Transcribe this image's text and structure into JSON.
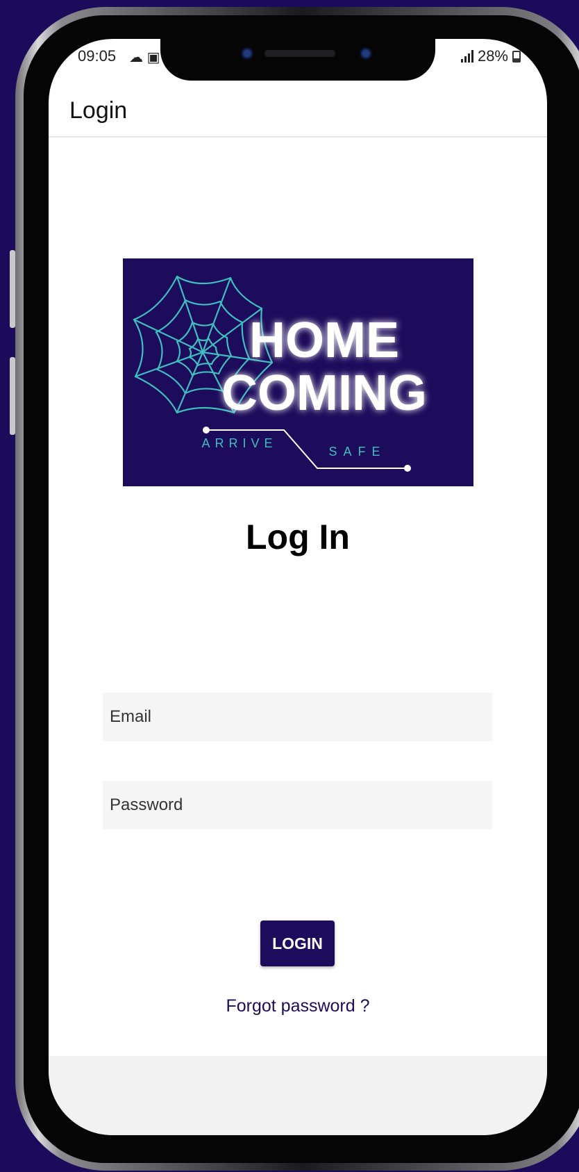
{
  "status_bar": {
    "time": "09:05",
    "left_icons": [
      "cloud-icon",
      "youtube-icon"
    ],
    "battery": "28%"
  },
  "app_bar": {
    "title": "Login"
  },
  "logo": {
    "line1": "HOME",
    "line2": "COMING",
    "tag_left": "ARRIVE",
    "tag_right": "SAFE",
    "colors": {
      "background": "#1d0b5b",
      "web": "#3fbfc0",
      "text": "#ffffff"
    }
  },
  "heading": "Log In",
  "form": {
    "email_placeholder": "Email",
    "password_placeholder": "Password",
    "login_label": "LOGIN",
    "forgot_label": "Forgot password ?"
  },
  "colors": {
    "accent": "#1d0b5b",
    "page_background": "#1b0b5a"
  }
}
